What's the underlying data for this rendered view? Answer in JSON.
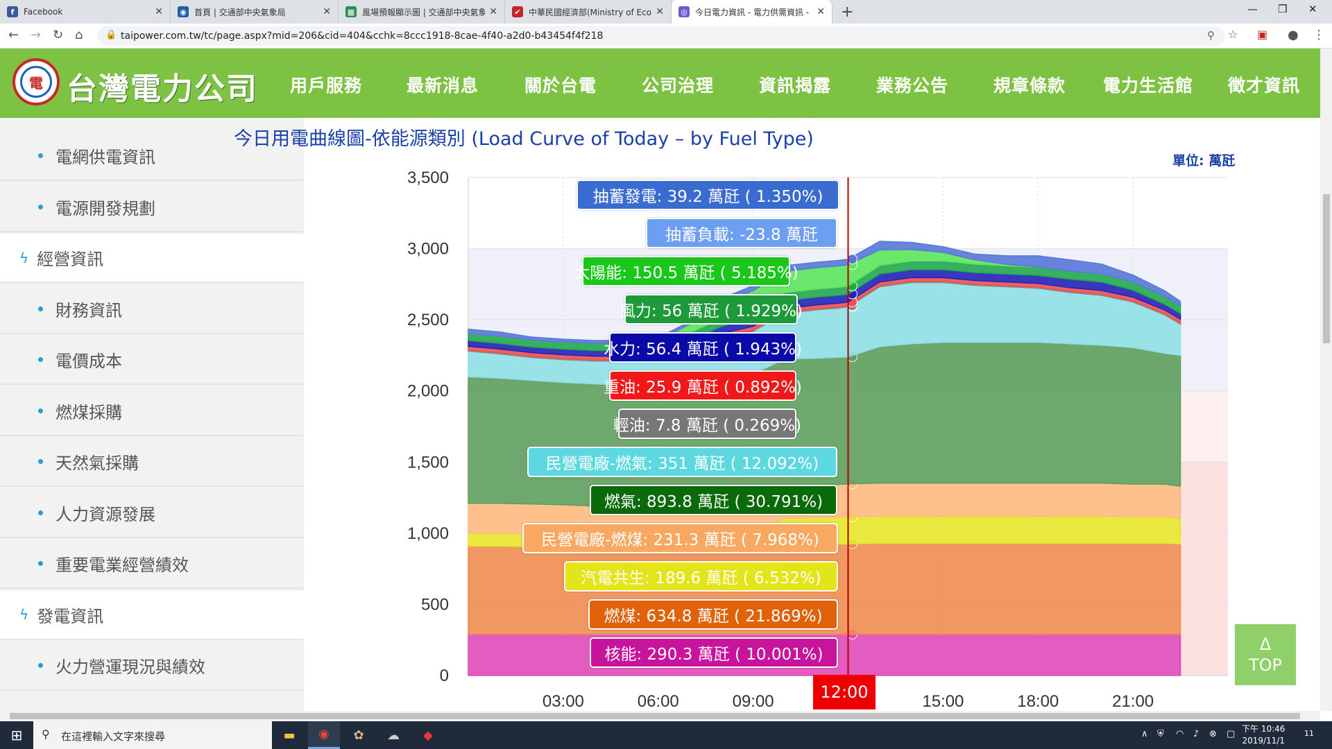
{
  "browser": {
    "tabs": [
      {
        "title": "Facebook",
        "icon": "facebook-icon",
        "color": "#3b5998",
        "glyph": "f"
      },
      {
        "title": "首頁 | 交通部中央氣象局",
        "icon": "cwb-icon",
        "color": "#1a5fa8",
        "glyph": "◉"
      },
      {
        "title": "風場預報顯示圖 | 交通部中央氣象",
        "icon": "cwb-map-icon",
        "color": "#2e8b57",
        "glyph": "▦"
      },
      {
        "title": "中華民國經濟部(Ministry of Econ",
        "icon": "moea-icon",
        "color": "#c62828",
        "glyph": "✔"
      },
      {
        "title": "今日電力資訊 - 電力供需資訊 - 台",
        "icon": "taipower-icon",
        "color": "#6a5acd",
        "glyph": "◎"
      }
    ],
    "new_tab": "+",
    "url": "taipower.com.tw/tc/page.aspx?mid=206&cid=404&cchk=8ccc1918-8cae-4f40-a2d0-b43454f4f218"
  },
  "site": {
    "logo_text": "台灣電力公司",
    "menu": [
      "用戶服務",
      "最新消息",
      "關於台電",
      "公司治理",
      "資訊揭露",
      "業務公告",
      "規章條款",
      "電力生活館",
      "徵才資訊"
    ]
  },
  "sidebar": [
    {
      "label": "電網供電資訊",
      "kind": "sub"
    },
    {
      "label": "電源開發規劃",
      "kind": "sub"
    },
    {
      "label": "經營資訊",
      "kind": "cat"
    },
    {
      "label": "財務資訊",
      "kind": "sub"
    },
    {
      "label": "電價成本",
      "kind": "sub"
    },
    {
      "label": "燃煤採購",
      "kind": "sub"
    },
    {
      "label": "天然氣採購",
      "kind": "sub"
    },
    {
      "label": "人力資源發展",
      "kind": "sub"
    },
    {
      "label": "重要電業經營績效",
      "kind": "sub"
    },
    {
      "label": "發電資訊",
      "kind": "cat"
    },
    {
      "label": "火力營運現況與績效",
      "kind": "sub"
    }
  ],
  "chart_data": {
    "type": "area",
    "title": "今日用電曲線圖-依能源類別 (Load Curve of Today – by Fuel Type)",
    "unit": "單位: 萬瓩",
    "ylim": [
      0,
      3500
    ],
    "yticks": [
      "0",
      "500",
      "1,000",
      "1,500",
      "2,000",
      "2,500",
      "3,000",
      "3,500"
    ],
    "xlim": [
      "00:00",
      "24:00"
    ],
    "xticks": [
      "03:00",
      "06:00",
      "09:00",
      "12:00",
      "15:00",
      "18:00",
      "21:00"
    ],
    "current_time": "12:00",
    "x": [
      "00:00",
      "01:00",
      "02:00",
      "03:00",
      "04:00",
      "05:00",
      "06:00",
      "07:00",
      "08:00",
      "09:00",
      "10:00",
      "11:00",
      "11:40",
      "12:00",
      "13:00",
      "14:00",
      "15:00",
      "16:00",
      "17:00",
      "18:00",
      "19:00",
      "20:00",
      "21:00",
      "22:00",
      "22:30"
    ],
    "series": [
      {
        "name": "核能",
        "color": "#e04ab8",
        "values": [
          290,
          290,
          290,
          290,
          290,
          290,
          290,
          290,
          290,
          290,
          290,
          290,
          290,
          290,
          290,
          290,
          290,
          290,
          290,
          290,
          290,
          290,
          290,
          290,
          290
        ]
      },
      {
        "name": "燃煤",
        "color": "#f08c50",
        "values": [
          620,
          620,
          615,
          610,
          600,
          590,
          585,
          600,
          620,
          630,
          635,
          635,
          635,
          635,
          640,
          640,
          640,
          640,
          640,
          640,
          640,
          640,
          640,
          640,
          635
        ]
      },
      {
        "name": "汽電共生",
        "color": "#e6e62a",
        "values": [
          90,
          90,
          90,
          90,
          90,
          90,
          90,
          90,
          90,
          90,
          180,
          185,
          188,
          190,
          190,
          190,
          190,
          190,
          190,
          190,
          190,
          190,
          185,
          185,
          180
        ]
      },
      {
        "name": "民營電廠-燃煤",
        "color": "#ffba80",
        "values": [
          210,
          210,
          210,
          210,
          210,
          210,
          210,
          210,
          210,
          210,
          220,
          225,
          230,
          231,
          232,
          232,
          232,
          232,
          232,
          232,
          232,
          232,
          230,
          230,
          225
        ]
      },
      {
        "name": "燃氣",
        "color": "#5e9e5e",
        "values": [
          890,
          880,
          870,
          860,
          860,
          860,
          870,
          890,
          900,
          900,
          900,
          895,
          894,
          894,
          960,
          980,
          990,
          990,
          990,
          990,
          980,
          970,
          960,
          920,
          920
        ]
      },
      {
        "name": "民營電廠-燃氣",
        "color": "#8ee0e6",
        "values": [
          180,
          170,
          160,
          160,
          160,
          170,
          170,
          200,
          260,
          300,
          320,
          340,
          345,
          351,
          420,
          430,
          420,
          400,
          390,
          380,
          360,
          350,
          320,
          270,
          220
        ]
      },
      {
        "name": "輕油",
        "color": "#888888",
        "values": [
          8,
          8,
          8,
          8,
          8,
          8,
          8,
          8,
          8,
          8,
          8,
          8,
          8,
          8,
          8,
          8,
          8,
          8,
          8,
          8,
          8,
          8,
          8,
          8,
          8
        ]
      },
      {
        "name": "重油",
        "color": "#f05050",
        "values": [
          26,
          26,
          26,
          26,
          26,
          26,
          26,
          26,
          26,
          26,
          26,
          26,
          26,
          26,
          26,
          26,
          26,
          26,
          26,
          26,
          26,
          26,
          26,
          26,
          26
        ]
      },
      {
        "name": "水力",
        "color": "#2424b8",
        "values": [
          40,
          40,
          40,
          40,
          40,
          40,
          40,
          40,
          50,
          55,
          56,
          56,
          56,
          56,
          56,
          56,
          56,
          56,
          56,
          56,
          60,
          60,
          50,
          40,
          40
        ]
      },
      {
        "name": "風力",
        "color": "#22a84e",
        "values": [
          50,
          50,
          50,
          50,
          50,
          52,
          54,
          55,
          56,
          56,
          56,
          56,
          56,
          56,
          60,
          62,
          62,
          60,
          58,
          58,
          56,
          56,
          56,
          56,
          56
        ]
      },
      {
        "name": "太陽能",
        "color": "#5ce65c",
        "values": [
          0,
          0,
          0,
          0,
          0,
          0,
          10,
          60,
          110,
          140,
          150,
          150,
          150,
          150,
          110,
          80,
          60,
          30,
          10,
          0,
          0,
          0,
          0,
          0,
          0
        ]
      },
      {
        "name": "抽蓄發電",
        "color": "#5878d8",
        "values": [
          30,
          30,
          20,
          20,
          20,
          20,
          20,
          20,
          30,
          35,
          39,
          39,
          39,
          39,
          60,
          50,
          40,
          40,
          60,
          80,
          80,
          70,
          50,
          40,
          30
        ]
      }
    ],
    "tooltip_values": [
      {
        "label": "抽蓄發電: 39.2 萬瓩 ( 1.350%)",
        "color": "#3a6bd0"
      },
      {
        "label": "抽蓄負載: -23.8 萬瓩",
        "color": "#6c9ef2"
      },
      {
        "label": "太陽能: 150.5 萬瓩 ( 5.185%)",
        "color": "#1cc71c"
      },
      {
        "label": "風力: 56 萬瓩 ( 1.929%)",
        "color": "#1f9a3a"
      },
      {
        "label": "水力: 56.4 萬瓩 ( 1.943%)",
        "color": "#0a0aa8"
      },
      {
        "label": "重油: 25.9 萬瓩 ( 0.892%)",
        "color": "#f01818"
      },
      {
        "label": "輕油: 7.8 萬瓩 ( 0.269%)",
        "color": "#777777"
      },
      {
        "label": "民營電廠-燃氣: 351 萬瓩 ( 12.092%)",
        "color": "#5ed8e0"
      },
      {
        "label": "燃氣: 893.8 萬瓩 ( 30.791%)",
        "color": "#0a6a0a"
      },
      {
        "label": "民營電廠-燃煤: 231.3 萬瓩 ( 7.968%)",
        "color": "#f8a860"
      },
      {
        "label": "汽電共生: 189.6 萬瓩 ( 6.532%)",
        "color": "#e4e41a"
      },
      {
        "label": "燃煤: 634.8 萬瓩 ( 21.869%)",
        "color": "#e0620a"
      },
      {
        "label": "核能: 290.3 萬瓩 ( 10.001%)",
        "color": "#c8149c"
      }
    ]
  },
  "top_button": {
    "arrow": "Δ",
    "label": "TOP"
  },
  "taskbar": {
    "search_placeholder": "在這裡輸入文字來搜尋",
    "time": "下午 10:46",
    "date": "2019/11/1",
    "notif_count": "11"
  }
}
